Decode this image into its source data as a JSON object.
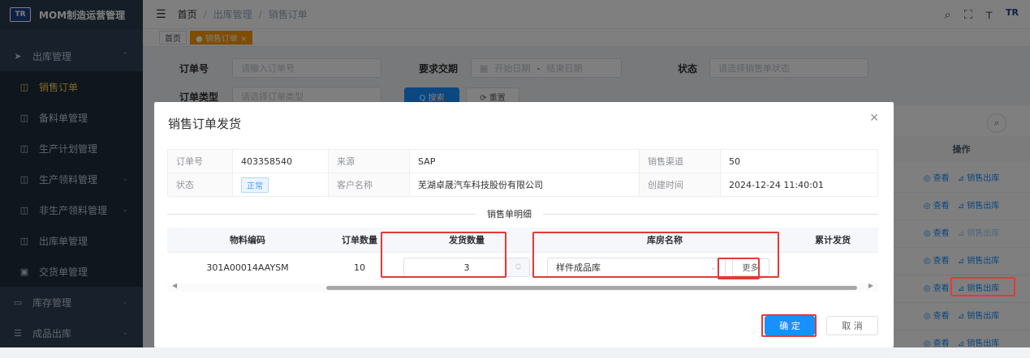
{
  "app": {
    "title": "MOM制造运营管理",
    "logo": "TR"
  },
  "sidebar": {
    "items": [
      {
        "label": "出库管理",
        "icon": "send-icon"
      },
      {
        "label": "销售订单",
        "icon": "grid-icon"
      },
      {
        "label": "备料单管理",
        "icon": "grid-icon"
      },
      {
        "label": "生产计划管理",
        "icon": "grid-icon"
      },
      {
        "label": "生产领料管理",
        "icon": "grid-icon"
      },
      {
        "label": "非生产领料管理",
        "icon": "grid-icon"
      },
      {
        "label": "出库单管理",
        "icon": "grid-icon"
      },
      {
        "label": "交货单管理",
        "icon": "calendar-icon"
      },
      {
        "label": "库存管理",
        "icon": "monitor-icon"
      },
      {
        "label": "成品出库",
        "icon": "list-icon"
      }
    ]
  },
  "header": {
    "breadcrumb": [
      "首页",
      "出库管理",
      "销售订单"
    ],
    "tools_logo": "TR"
  },
  "tags": {
    "home": "首页",
    "current": "● 销售订单 ×"
  },
  "search": {
    "order_no_label": "订单号",
    "order_no_placeholder": "请输入订单号",
    "delivery_label": "要求交期",
    "start_placeholder": "开始日期",
    "range_sep": "-",
    "end_placeholder": "结束日期",
    "status_label": "状态",
    "status_placeholder": "请选择销售单状态",
    "type_label": "订单类型",
    "type_placeholder": "请选择订单类型",
    "search_btn": "Q 搜索",
    "reset_btn": "⟳ 重置"
  },
  "background_table": {
    "op_header": "操作",
    "view": "◎ 查看",
    "ship": "⊿ 销售出库"
  },
  "dialog": {
    "title": "销售订单发货",
    "info": {
      "order_no_label": "订单号",
      "order_no": "403358540",
      "source_label": "来源",
      "source": "SAP",
      "channel_label": "销售渠道",
      "channel": "50",
      "status_label": "状态",
      "status": "正常",
      "customer_label": "客户名称",
      "customer": "芜湖卓晟汽车科技股份有限公司",
      "created_label": "创建时间",
      "created": "2024-12-24 11:40:01"
    },
    "detail_title": "销售单明细",
    "columns": [
      "物料编码",
      "订单数量",
      "发货数量",
      "库房名称",
      "累计发货"
    ],
    "row": {
      "material_code": "301A00014AAYSM",
      "order_qty": "10",
      "ship_qty": "3",
      "warehouse": "样件成品库",
      "more": "更多",
      "cumulative": ""
    },
    "ok": "确 定",
    "cancel": "取 消"
  },
  "colors": {
    "accent": "#1890ff",
    "highlight": "#e53935",
    "sidebar": "#304156",
    "active_menu": "#ffd04b"
  }
}
